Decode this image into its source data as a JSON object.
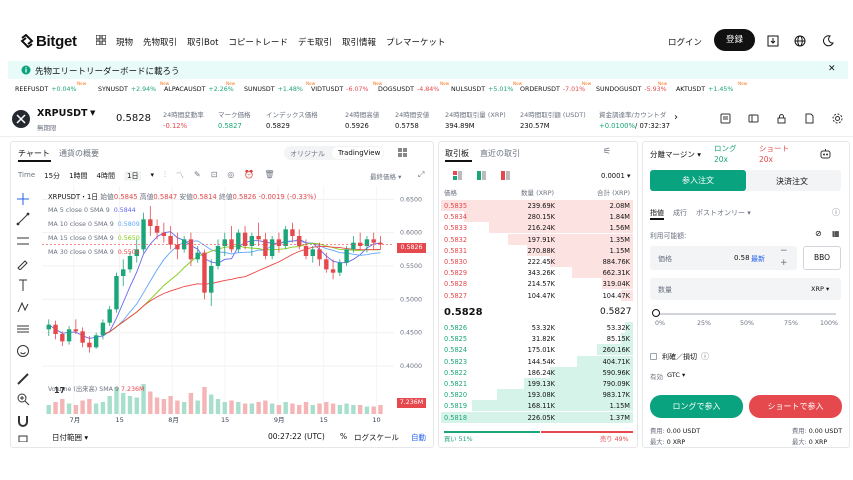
{
  "nav": {
    "brand": "Bitget",
    "menu": [
      "現物",
      "先物取引",
      "取引Bot",
      "コピートレード",
      "デモ取引",
      "取引情報",
      "プレマーケット"
    ],
    "login": "ログイン",
    "register": "登録"
  },
  "banner": {
    "text": "先物エリートリーダーボードに載ろう"
  },
  "ticker": [
    {
      "sym": "REEFUSDT",
      "chg": "+0.04%",
      "dir": "up",
      "new": "New"
    },
    {
      "sym": "SYNUSDT",
      "chg": "+2.94%",
      "dir": "up",
      "new": "New"
    },
    {
      "sym": "ALPACAUSDT",
      "chg": "+2.26%",
      "dir": "up",
      "new": "New"
    },
    {
      "sym": "SUNUSDT",
      "chg": "+1.48%",
      "dir": "up",
      "new": "New"
    },
    {
      "sym": "VIDTUSDT",
      "chg": "-6.07%",
      "dir": "down",
      "new": "New"
    },
    {
      "sym": "DOGSUSDT",
      "chg": "-4.84%",
      "dir": "down",
      "new": "New"
    },
    {
      "sym": "NULSUSDT",
      "chg": "+5.01%",
      "dir": "up",
      "new": "New"
    },
    {
      "sym": "ORDERUSDT",
      "chg": "-7.01%",
      "dir": "down",
      "new": "New"
    },
    {
      "sym": "SUNDOGUSDT",
      "chg": "-5.93%",
      "dir": "down",
      "new": "New"
    },
    {
      "sym": "AKTUSDT",
      "chg": "+1.45%",
      "dir": "up",
      "new": "New"
    }
  ],
  "header": {
    "pair": "XRPUSDT",
    "contract": "無期限",
    "price": "0.5828",
    "stats": [
      {
        "label": "24時間変動率",
        "value": "-0.12%",
        "cls": "r"
      },
      {
        "label": "マーク価格",
        "value": "0.5827",
        "cls": "g"
      },
      {
        "label": "インデックス価格",
        "value": "0.5829",
        "cls": ""
      },
      {
        "label": "24時間高値",
        "value": "0.5926",
        "cls": ""
      },
      {
        "label": "24時間安値",
        "value": "0.5758",
        "cls": ""
      },
      {
        "label": "24時間取引量 (XRP)",
        "value": "394.89M",
        "cls": ""
      },
      {
        "label": "24時間取引額 (USDT)",
        "value": "230.57M",
        "cls": ""
      },
      {
        "label": "資金調達率/カウントダ",
        "value": "+0.0100%",
        "value2": "/ 07:32:37",
        "cls": "g"
      }
    ]
  },
  "chart": {
    "tabs": [
      "チャート",
      "通貨の概要"
    ],
    "views": [
      "オリジナル",
      "TradingView"
    ],
    "toolbar": {
      "time": "Time",
      "t15": "15分",
      "t1h": "1時間",
      "t4h": "4時間",
      "t1d": "1日",
      "last": "最終価格"
    },
    "legend": {
      "title": "XRPUSDT・1日",
      "o_l": "始値",
      "o": "0.5845",
      "h_l": "高値",
      "h": "0.5847",
      "l_l": "安値",
      "l": "0.5814",
      "c_l": "終値",
      "c": "0.5826",
      "chg": "-0.0019 (-0.33%)",
      "ma": [
        {
          "t": "MA 5 close 0 SMA 9",
          "v": "0.5844",
          "c": "#6366f1"
        },
        {
          "t": "MA 10 close 0 SMA 9",
          "v": "0.5809",
          "c": "#60a5fa"
        },
        {
          "t": "MA 15 close 0 SMA 9",
          "v": "0.5650",
          "c": "#84cc16"
        },
        {
          "t": "MA 30 close 0 SMA 9",
          "v": "0.5503",
          "c": "#ef4444"
        }
      ]
    },
    "volume": {
      "label": "Volume (出来高) SMA 9",
      "value": "7.236M",
      "tag": "7.236M"
    },
    "price_tag": "0.5826",
    "bottom": {
      "range": "日付範囲",
      "time": "00:27:22 (UTC)",
      "pct": "%",
      "log": "ログスケール",
      "auto": "自動"
    }
  },
  "chart_data": {
    "type": "candlestick",
    "title": "XRPUSDT・1日",
    "y_ticks": [
      "0.6500",
      "0.6000",
      "0.5500",
      "0.5000",
      "0.4500",
      "0.4000"
    ],
    "x_ticks": [
      "7月",
      "15",
      "8月",
      "15",
      "9月",
      "15",
      "10"
    ],
    "ylim": [
      0.37,
      0.67
    ],
    "candles": [
      [
        0.455,
        0.47,
        0.445,
        0.462
      ],
      [
        0.462,
        0.468,
        0.44,
        0.448
      ],
      [
        0.448,
        0.452,
        0.43,
        0.437
      ],
      [
        0.437,
        0.46,
        0.432,
        0.455
      ],
      [
        0.455,
        0.47,
        0.448,
        0.452
      ],
      [
        0.452,
        0.458,
        0.428,
        0.435
      ],
      [
        0.435,
        0.445,
        0.42,
        0.428
      ],
      [
        0.428,
        0.45,
        0.426,
        0.446
      ],
      [
        0.446,
        0.47,
        0.44,
        0.465
      ],
      [
        0.465,
        0.49,
        0.46,
        0.485
      ],
      [
        0.485,
        0.54,
        0.48,
        0.535
      ],
      [
        0.535,
        0.56,
        0.52,
        0.545
      ],
      [
        0.545,
        0.57,
        0.54,
        0.565
      ],
      [
        0.565,
        0.59,
        0.555,
        0.575
      ],
      [
        0.575,
        0.63,
        0.57,
        0.62
      ],
      [
        0.62,
        0.64,
        0.595,
        0.61
      ],
      [
        0.61,
        0.62,
        0.59,
        0.6
      ],
      [
        0.6,
        0.615,
        0.585,
        0.595
      ],
      [
        0.595,
        0.61,
        0.575,
        0.582
      ],
      [
        0.582,
        0.6,
        0.56,
        0.575
      ],
      [
        0.575,
        0.595,
        0.57,
        0.59
      ],
      [
        0.59,
        0.6,
        0.55,
        0.56
      ],
      [
        0.56,
        0.58,
        0.555,
        0.57
      ],
      [
        0.57,
        0.575,
        0.5,
        0.51
      ],
      [
        0.51,
        0.56,
        0.49,
        0.55
      ],
      [
        0.55,
        0.59,
        0.545,
        0.58
      ],
      [
        0.58,
        0.6,
        0.565,
        0.59
      ],
      [
        0.59,
        0.61,
        0.57,
        0.575
      ],
      [
        0.575,
        0.605,
        0.57,
        0.6
      ],
      [
        0.6,
        0.61,
        0.575,
        0.58
      ],
      [
        0.58,
        0.6,
        0.565,
        0.595
      ],
      [
        0.595,
        0.615,
        0.58,
        0.59
      ],
      [
        0.59,
        0.6,
        0.56,
        0.565
      ],
      [
        0.565,
        0.595,
        0.56,
        0.59
      ],
      [
        0.59,
        0.6,
        0.57,
        0.58
      ],
      [
        0.58,
        0.61,
        0.575,
        0.605
      ],
      [
        0.605,
        0.615,
        0.585,
        0.595
      ],
      [
        0.595,
        0.605,
        0.575,
        0.58
      ],
      [
        0.58,
        0.59,
        0.56,
        0.565
      ],
      [
        0.565,
        0.58,
        0.555,
        0.575
      ],
      [
        0.575,
        0.585,
        0.55,
        0.56
      ],
      [
        0.56,
        0.57,
        0.54,
        0.545
      ],
      [
        0.545,
        0.56,
        0.53,
        0.54
      ],
      [
        0.54,
        0.56,
        0.535,
        0.555
      ],
      [
        0.555,
        0.58,
        0.55,
        0.575
      ],
      [
        0.575,
        0.595,
        0.57,
        0.585
      ],
      [
        0.585,
        0.6,
        0.575,
        0.58
      ],
      [
        0.58,
        0.595,
        0.57,
        0.59
      ],
      [
        0.59,
        0.6,
        0.575,
        0.585
      ],
      [
        0.585,
        0.595,
        0.575,
        0.5826
      ]
    ],
    "volumes": [
      0.3,
      0.4,
      0.5,
      0.35,
      0.3,
      0.45,
      0.5,
      0.35,
      0.4,
      0.6,
      0.9,
      0.7,
      0.6,
      0.55,
      1.0,
      0.75,
      0.55,
      0.5,
      0.6,
      0.45,
      0.4,
      0.7,
      0.45,
      0.9,
      0.65,
      0.5,
      0.4,
      0.45,
      0.4,
      0.35,
      0.35,
      0.4,
      0.45,
      0.35,
      0.3,
      0.4,
      0.35,
      0.3,
      0.4,
      0.3,
      0.35,
      0.4,
      0.35,
      0.3,
      0.35,
      0.3,
      0.3,
      0.25,
      0.25,
      0.3
    ]
  },
  "orderbook": {
    "tabs": [
      "取引板",
      "直近の取引"
    ],
    "precision": "0.0001",
    "cols": [
      "価格",
      "数量 (XRP)",
      "合計 (XRP)"
    ],
    "asks": [
      [
        "0.5835",
        "239.69K",
        "2.08M",
        1.0
      ],
      [
        "0.5834",
        "280.15K",
        "1.84M",
        0.88
      ],
      [
        "0.5833",
        "216.24K",
        "1.56M",
        0.75
      ],
      [
        "0.5832",
        "197.91K",
        "1.35M",
        0.65
      ],
      [
        "0.5831",
        "270.88K",
        "1.15M",
        0.55
      ],
      [
        "0.5830",
        "222.45K",
        "884.76K",
        0.43
      ],
      [
        "0.5829",
        "343.26K",
        "662.31K",
        0.32
      ],
      [
        "0.5828",
        "214.57K",
        "319.04K",
        0.16
      ],
      [
        "0.5827",
        "104.47K",
        "104.47K",
        0.06
      ]
    ],
    "last": "0.5828",
    "mark": "0.5827",
    "bids": [
      [
        "0.5826",
        "53.32K",
        "53.32K",
        0.04
      ],
      [
        "0.5825",
        "31.82K",
        "85.15K",
        0.06
      ],
      [
        "0.5824",
        "175.01K",
        "260.16K",
        0.19
      ],
      [
        "0.5823",
        "144.54K",
        "404.71K",
        0.29
      ],
      [
        "0.5822",
        "186.24K",
        "590.96K",
        0.43
      ],
      [
        "0.5821",
        "199.13K",
        "790.09K",
        0.57
      ],
      [
        "0.5820",
        "193.08K",
        "983.17K",
        0.71
      ],
      [
        "0.5819",
        "168.11K",
        "1.15M",
        0.84
      ],
      [
        "0.5818",
        "226.05K",
        "1.37M",
        1.0
      ]
    ],
    "buy_pct": "買い 51%",
    "sell_pct": "売り 49%"
  },
  "trade": {
    "margin": "分離マージン",
    "long": "ロング",
    "long_lev": "20x",
    "short": "ショート",
    "short_lev": "20x",
    "open": "参入注文",
    "close": "決済注文",
    "types": [
      "指値",
      "成行",
      "ポストオンリー"
    ],
    "avail": "利用可能額:",
    "price_label": "価格",
    "price_val": "0.58",
    "latest": "最新",
    "bbo": "BBO",
    "qty_label": "数量",
    "qty_unit": "XRP",
    "slider": [
      "0%",
      "25%",
      "50%",
      "75%",
      "100%"
    ],
    "tpsl": "利確／損切",
    "tif_label": "有効",
    "tif": "GTC",
    "buy_btn": "ロングで参入",
    "sell_btn": "ショートで参入",
    "cost_l": "費用:",
    "cost_v": "0.00 USDT",
    "max_l": "最大:",
    "max_v": "0 XRP"
  }
}
